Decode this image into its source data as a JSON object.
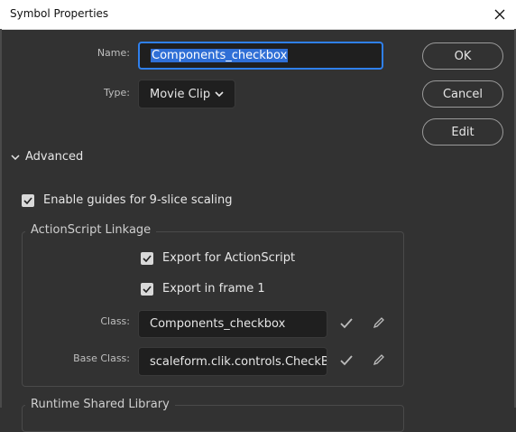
{
  "window": {
    "title": "Symbol Properties"
  },
  "name_field": {
    "label": "Name:",
    "value": "Components_checkbox"
  },
  "type_field": {
    "label": "Type:",
    "value": "Movie Clip"
  },
  "buttons": {
    "ok": "OK",
    "cancel": "Cancel",
    "edit": "Edit"
  },
  "advanced": {
    "label": "Advanced",
    "nine_slice": {
      "label": "Enable guides for 9-slice scaling",
      "checked": true
    }
  },
  "linkage": {
    "legend": "ActionScript Linkage",
    "export_as": {
      "label": "Export for ActionScript",
      "checked": true
    },
    "export_frame1": {
      "label": "Export in frame 1",
      "checked": true
    },
    "class": {
      "label": "Class:",
      "value": "Components_checkbox"
    },
    "base_class": {
      "label": "Base Class:",
      "value": "scaleform.clik.controls.CheckBox"
    }
  },
  "runtime": {
    "legend": "Runtime Shared Library"
  },
  "colors": {
    "accent": "#2f80ed",
    "bg": "#323232",
    "field": "#1f1f1f"
  }
}
